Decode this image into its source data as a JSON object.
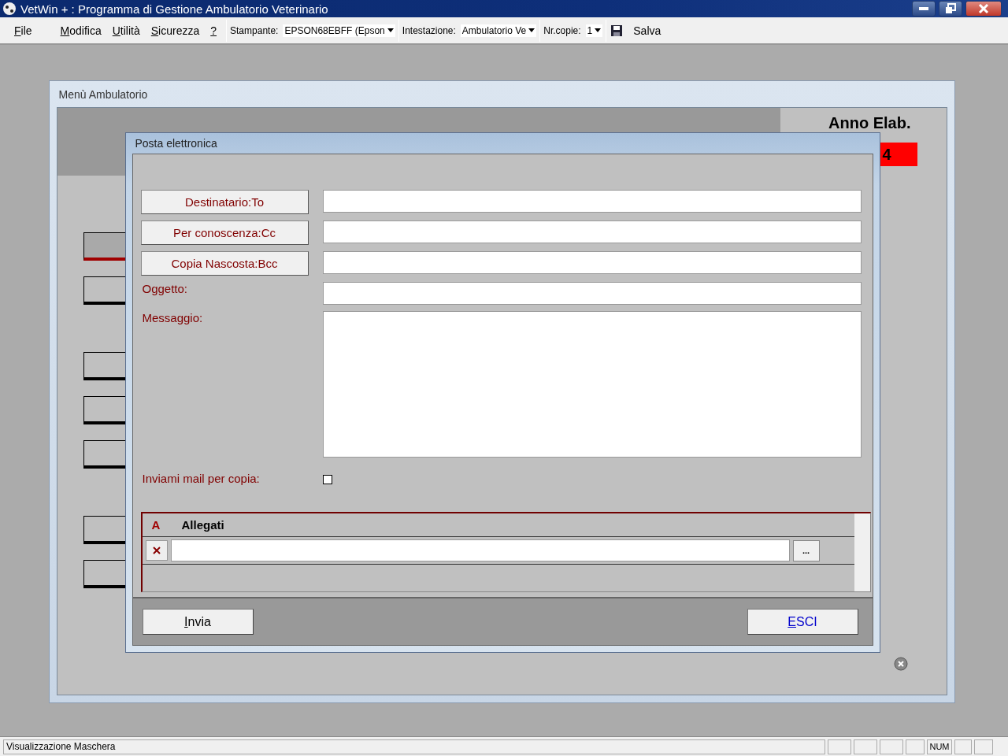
{
  "window": {
    "title": "VetWin + : Programma di Gestione Ambulatorio Veterinario"
  },
  "menu": [
    {
      "label": "File",
      "mnemonic": true
    },
    {
      "label": "Modifica",
      "mnemonic": true
    },
    {
      "label": "Utilità",
      "mnemonic": true
    },
    {
      "label": "Sicurezza",
      "mnemonic": true
    },
    {
      "label": "?",
      "mnemonic": true
    }
  ],
  "toolbar": {
    "printer_label": "Stampante:",
    "printer_value": "EPSON68EBFF (Epson",
    "header_label": "Intestazione:",
    "header_value": "Ambulatorio Ve",
    "copies_label": "Nr.copie:",
    "copies_value": "1",
    "save": "Salva"
  },
  "menu_window": {
    "title": "Menù Ambulatorio",
    "year_label": "Anno Elab.",
    "year_value": "4",
    "button_groups": [
      {
        "buttons": [
          {
            "selected": true
          },
          {
            "selected": false
          }
        ]
      },
      {
        "buttons": [
          {
            "selected": false
          },
          {
            "selected": false
          },
          {
            "selected": false
          }
        ]
      },
      {
        "buttons": [
          {
            "selected": false
          },
          {
            "selected": false
          }
        ]
      }
    ]
  },
  "dialog": {
    "title": "Posta elettronica",
    "fields": [
      {
        "kind": "button",
        "label": "Destinatario:To"
      },
      {
        "kind": "button",
        "label": "Per conoscenza:Cc"
      },
      {
        "kind": "button",
        "label": "Copia Nascosta:Bcc"
      },
      {
        "kind": "label",
        "label": "Oggetto:"
      }
    ],
    "message_label": "Messaggio:",
    "copy": {
      "label": "Inviami mail per copia:",
      "checked": false
    },
    "attachments": {
      "marker": "A",
      "title": "Allegati",
      "browse": "..."
    },
    "send": {
      "label": "Invia",
      "mnemonic": true
    },
    "exit": {
      "label": "ESCI",
      "mnemonic": true
    }
  },
  "status_bar": {
    "text": "Visualizzazione Maschera",
    "indicator": "NUM"
  }
}
